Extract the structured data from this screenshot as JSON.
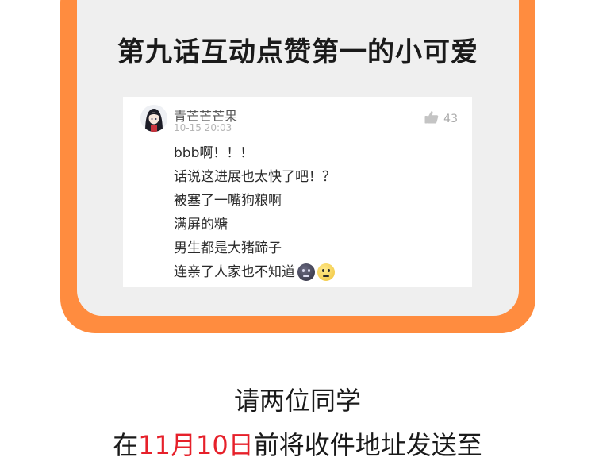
{
  "headline": "第九话互动点赞第一的小可爱",
  "comment": {
    "username": "青芒芒芒果",
    "timestamp": "10-15 20:03",
    "likes": "43",
    "lines": [
      "bbb啊！！！",
      "话说这进展也太快了吧！？",
      "被塞了一嘴狗粮啊",
      "满屏的糖",
      "男生都是大猪蹄子",
      "连亲了人家也不知道"
    ],
    "emojis": [
      "dark-moon-face-icon",
      "neutral-face-icon"
    ]
  },
  "footer": {
    "line1": "请两位同学",
    "line2_prefix": "在",
    "line2_highlight": "11月10日",
    "line2_suffix": "前将收件地址发送至"
  },
  "colors": {
    "card_border": "#ff8c3f",
    "card_fill": "#efefef",
    "highlight": "#e6202a"
  }
}
